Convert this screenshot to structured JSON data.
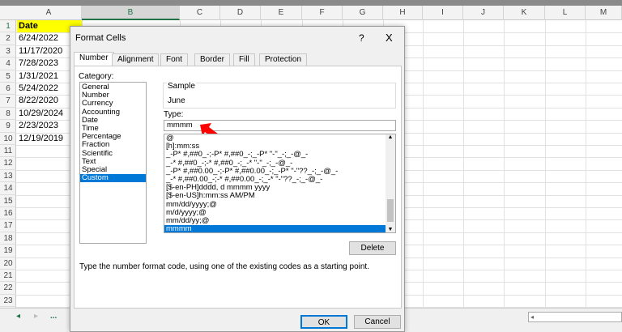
{
  "spreadsheet": {
    "columns": [
      "A",
      "B",
      "C",
      "D",
      "E",
      "F",
      "G",
      "H",
      "I",
      "J",
      "K",
      "L",
      "M"
    ],
    "rows": [
      "1",
      "2",
      "3",
      "4",
      "5",
      "6",
      "7",
      "8",
      "9",
      "10",
      "11",
      "12",
      "13",
      "14",
      "15",
      "16",
      "17",
      "18",
      "19",
      "20",
      "21",
      "22",
      "23"
    ],
    "cells_a": [
      "Date",
      "6/24/2022",
      "11/17/2020",
      "7/28/2023",
      "1/31/2021",
      "5/24/2022",
      "8/22/2020",
      "10/29/2024",
      "2/23/2023",
      "12/19/2019"
    ],
    "header_fill": "#ffff00",
    "sheet_nav_more": "..."
  },
  "dialog": {
    "title": "Format Cells",
    "help": "?",
    "close": "X",
    "tabs": [
      "Number",
      "Alignment",
      "Font",
      "Border",
      "Fill",
      "Protection"
    ],
    "active_tab": "Number",
    "category_label": "Category:",
    "categories": [
      "General",
      "Number",
      "Currency",
      "Accounting",
      "Date",
      "Time",
      "Percentage",
      "Fraction",
      "Scientific",
      "Text",
      "Special",
      "Custom"
    ],
    "selected_category": "Custom",
    "sample_label": "Sample",
    "sample_value": "June",
    "type_label": "Type:",
    "type_value": "mmmm",
    "formats": [
      "@",
      "[h]:mm:ss",
      "_-P* #,##0_-;-P* #,##0_-;_-P* \"-\"_-;_-@_-",
      "_-* #,##0_-;-* #,##0_-;_-* \"-\"_-;_-@_-",
      "_-P* #,##0.00_-;-P* #,##0.00_-;_-P* \"-\"??_-;_-@_-",
      "_-* #,##0.00_-;-* #,##0.00_-;_-* \"-\"??_-;_-@_-",
      "[$-en-PH]dddd, d mmmm yyyy",
      "[$-en-US]h:mm:ss AM/PM",
      "mm/dd/yyyy;@",
      "m/d/yyyy;@",
      "mm/dd/yy;@",
      "mmmm"
    ],
    "selected_format": "mmmm",
    "delete_label": "Delete",
    "description": "Type the number format code, using one of the existing codes as a starting point.",
    "ok_label": "OK",
    "cancel_label": "Cancel",
    "selection_color": "#0078d7",
    "arrow_color": "#ff0000"
  }
}
